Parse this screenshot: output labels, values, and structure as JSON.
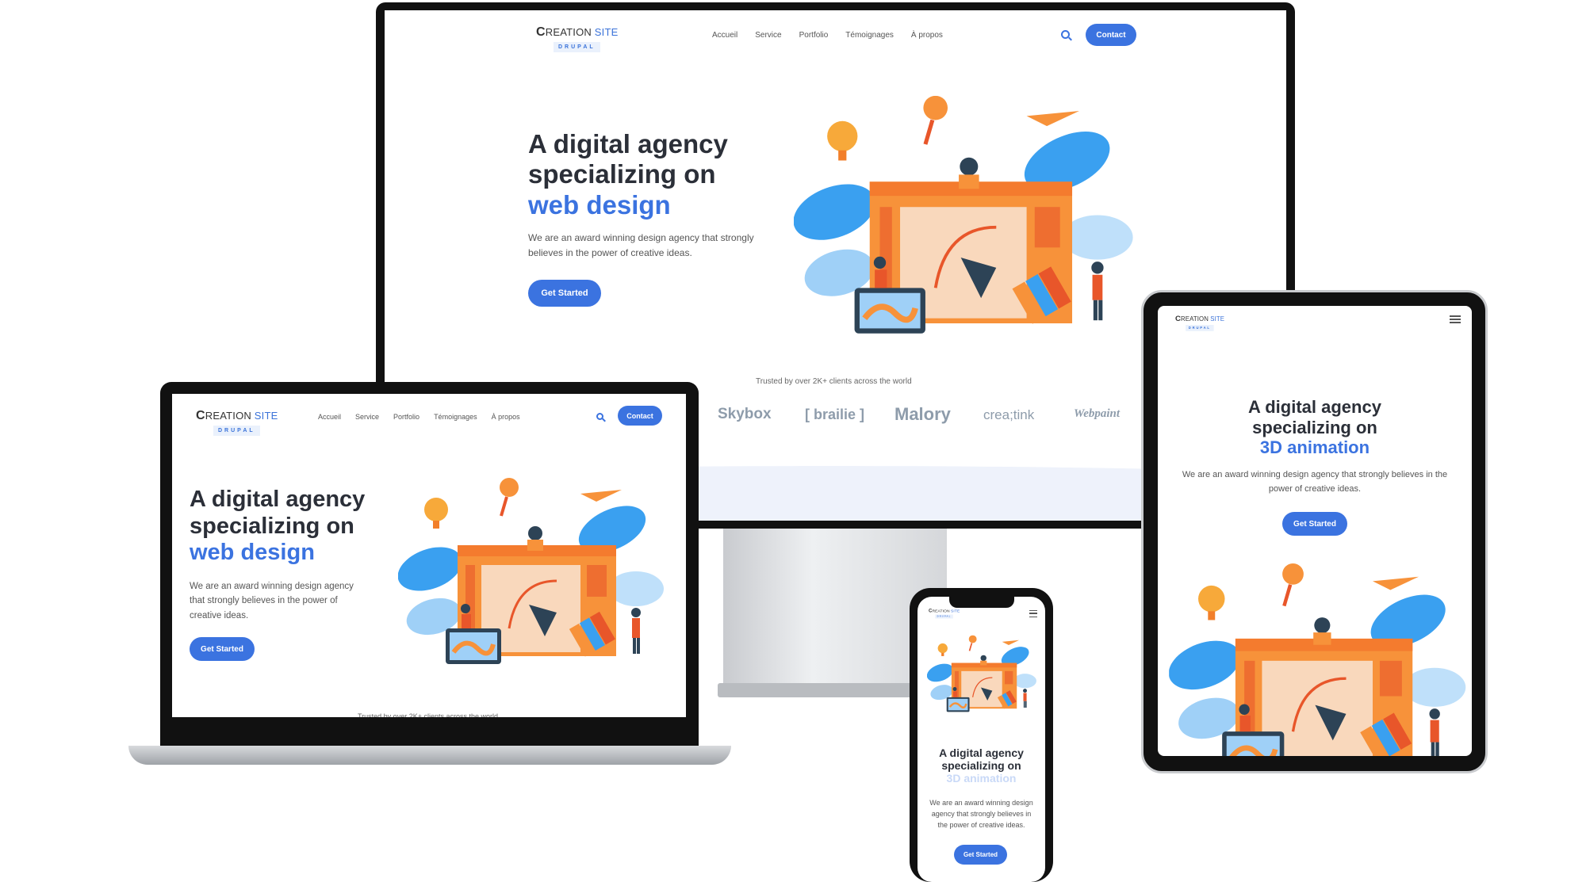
{
  "site": {
    "logo_main": "REATION",
    "logo_c": "C",
    "logo_site": "SITE",
    "logo_sub": "DRUPAL",
    "nav": [
      "Accueil",
      "Service",
      "Portfolio",
      "Témoignages",
      "À propos"
    ],
    "contact_label": "Contact",
    "hero_line1": "A digital agency",
    "hero_line2": "specializing on",
    "hero_highlight_web": "web design",
    "hero_highlight_3d": "3D animation",
    "hero_description": "We are an award winning design agency that strongly believes in the power of creative ideas.",
    "cta_label": "Get Started",
    "trusted_text": "Trusted by over 2K+ clients across the world",
    "client_logos": [
      "Skybox",
      "[ brailie ]",
      "Malory",
      "crea;tink",
      "Webpaint"
    ]
  },
  "colors": {
    "accent": "#3b73e0",
    "orange": "#f7923a",
    "leaf_blue": "#3aa0f0",
    "logo_gray": "#8e9cab"
  },
  "icons": [
    "search-icon",
    "hamburger-menu-icon"
  ]
}
